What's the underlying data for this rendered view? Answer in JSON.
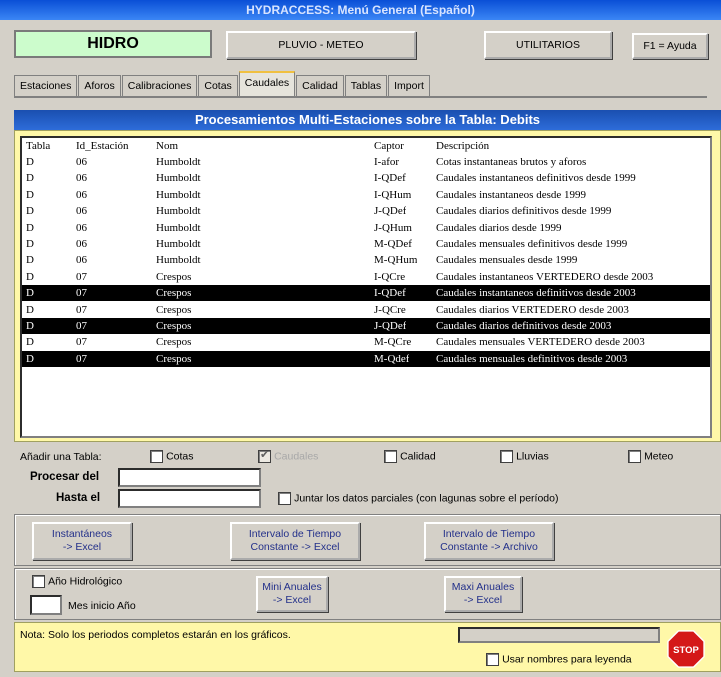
{
  "window": {
    "title": "HYDRACCESS: Menú General (Español)"
  },
  "top": {
    "hidro_label": "HIDRO",
    "pluvio_label": "PLUVIO - METEO",
    "utilitarios_label": "UTILITARIOS",
    "ayuda_label": "F1 = Ayuda"
  },
  "tabs": [
    {
      "label": "Estaciones"
    },
    {
      "label": "Aforos"
    },
    {
      "label": "Calibraciones"
    },
    {
      "label": "Cotas"
    },
    {
      "label": "Caudales",
      "active": true
    },
    {
      "label": "Calidad"
    },
    {
      "label": "Tablas"
    },
    {
      "label": "Import"
    }
  ],
  "subtitle": "Procesamientos Multi-Estaciones sobre la Tabla: Debits",
  "table": {
    "headers": [
      "Tabla",
      "Id_Estación",
      "Nom",
      "Captor",
      "Descripción"
    ],
    "rows": [
      {
        "cells": [
          "D",
          "06",
          "Humboldt",
          "I-afor",
          "Cotas instantaneas brutos y aforos"
        ],
        "selected": false
      },
      {
        "cells": [
          "D",
          "06",
          "Humboldt",
          "I-QDef",
          "Caudales instantaneos definitivos desde 1999"
        ],
        "selected": false
      },
      {
        "cells": [
          "D",
          "06",
          "Humboldt",
          "I-QHum",
          "Caudales instantaneos desde 1999"
        ],
        "selected": false
      },
      {
        "cells": [
          "D",
          "06",
          "Humboldt",
          "J-QDef",
          "Caudales diarios definitivos desde 1999"
        ],
        "selected": false
      },
      {
        "cells": [
          "D",
          "06",
          "Humboldt",
          "J-QHum",
          "Caudales diarios desde 1999"
        ],
        "selected": false
      },
      {
        "cells": [
          "D",
          "06",
          "Humboldt",
          "M-QDef",
          "Caudales mensuales definitivos desde 1999"
        ],
        "selected": false
      },
      {
        "cells": [
          "D",
          "06",
          "Humboldt",
          "M-QHum",
          "Caudales mensuales desde 1999"
        ],
        "selected": false
      },
      {
        "cells": [
          "D",
          "07",
          "Crespos",
          "I-QCre",
          "Caudales instantaneos VERTEDERO desde 2003"
        ],
        "selected": false
      },
      {
        "cells": [
          "D",
          "07",
          "Crespos",
          "I-QDef",
          "Caudales instantaneos definitivos desde 2003"
        ],
        "selected": true
      },
      {
        "cells": [
          "D",
          "07",
          "Crespos",
          "J-QCre",
          "Caudales diarios VERTEDERO desde 2003"
        ],
        "selected": false
      },
      {
        "cells": [
          "D",
          "07",
          "Crespos",
          "J-QDef",
          "Caudales diarios definitivos desde 2003"
        ],
        "selected": true
      },
      {
        "cells": [
          "D",
          "07",
          "Crespos",
          "M-QCre",
          "Caudales mensuales VERTEDERO desde 2003"
        ],
        "selected": false
      },
      {
        "cells": [
          "D",
          "07",
          "Crespos",
          "M-Qdef",
          "Caudales mensuales definitivos desde 2003"
        ],
        "selected": true
      }
    ]
  },
  "add_table": {
    "label": "Añadir una Tabla:",
    "options": [
      {
        "label": "Cotas",
        "checked": false,
        "disabled": false
      },
      {
        "label": "Caudales",
        "checked": true,
        "disabled": true
      },
      {
        "label": "Calidad",
        "checked": false,
        "disabled": false
      },
      {
        "label": "Lluvias",
        "checked": false,
        "disabled": false
      },
      {
        "label": "Meteo",
        "checked": false,
        "disabled": false
      }
    ]
  },
  "period": {
    "from_label": "Procesar del",
    "to_label": "Hasta el",
    "from_value": "",
    "to_value": "",
    "join_label": "Juntar los datos parciales (con lagunas sobre el período)"
  },
  "actions": {
    "instant_line1": "Instantáneos",
    "instant_line2": "-> Excel",
    "interval_excel_line1": "Intervalo de Tiempo",
    "interval_excel_line2": "Constante -> Excel",
    "interval_file_line1": "Intervalo de Tiempo",
    "interval_file_line2": "Constante -> Archivo"
  },
  "annual": {
    "hydro_year_label": "Año Hidrológico",
    "month_start_label": "Mes inicio Año",
    "month_start_value": "",
    "mini_line1": "Mini Anuales",
    "mini_line2": "-> Excel",
    "maxi_line1": "Maxi Anuales",
    "maxi_line2": "-> Excel"
  },
  "footer": {
    "note": "Nota: Solo los periodos completos estarán en los gráficos.",
    "legend_names_label": "Usar nombres para leyenda",
    "stop_label": "STOP"
  }
}
